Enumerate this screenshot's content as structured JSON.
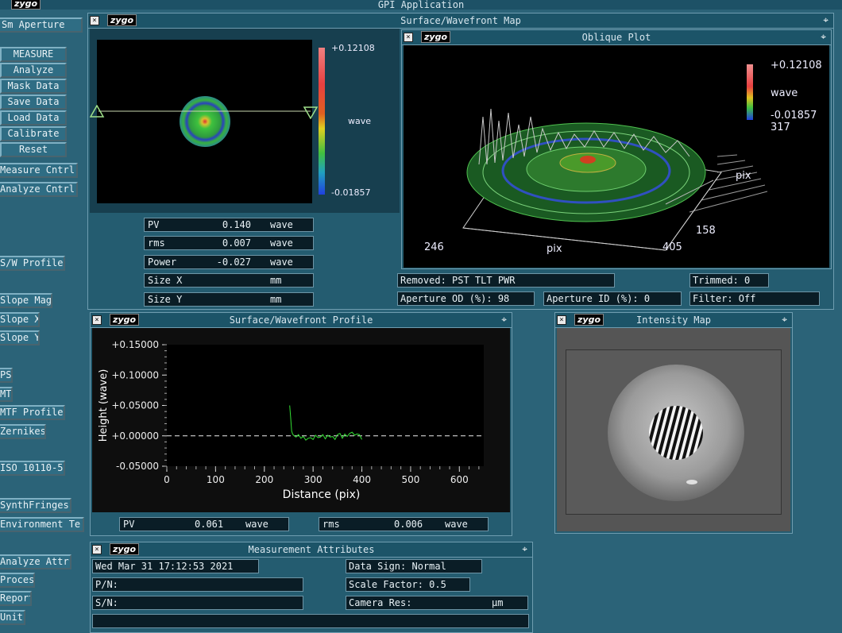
{
  "app": {
    "title": "GPI Application",
    "logo": "zygo"
  },
  "sidebar": {
    "top_label": "Sm Aperture",
    "buttons": [
      "MEASURE",
      "Analyze",
      "Mask Data",
      "Save Data",
      "Load Data",
      "Calibrate",
      "Reset"
    ],
    "items": [
      "Measure Cntrl",
      "Analyze Cntrl",
      "S/W Profile",
      "Slope Mag",
      "Slope X",
      "Slope Y",
      "PSF",
      "MTF",
      "MTF Profile",
      "Zernikes",
      "ISO 10110-5",
      "SynthFringes",
      "Environment Te",
      "Analyze Attr",
      "Process",
      "Report",
      "Units"
    ]
  },
  "surface_map": {
    "title": "Surface/Wavefront Map",
    "colorbar_max": "+0.12108",
    "colorbar_min": "-0.01857",
    "colorbar_unit": "wave",
    "results": [
      {
        "label": "PV",
        "value": "0.140",
        "unit": "wave"
      },
      {
        "label": "rms",
        "value": "0.007",
        "unit": "wave"
      },
      {
        "label": "Power",
        "value": "-0.027",
        "unit": "wave"
      },
      {
        "label": "Size X",
        "value": "",
        "unit": "mm"
      },
      {
        "label": "Size Y",
        "value": "",
        "unit": "mm"
      }
    ]
  },
  "oblique": {
    "title": "Oblique Plot",
    "colorbar_max": "+0.12108",
    "colorbar_unit": "wave",
    "colorbar_min": "-0.01857",
    "y_top": "317",
    "y_unit": "pix",
    "y_bottom": "158",
    "x_left": "246",
    "x_unit": "pix",
    "x_right": "405"
  },
  "status": {
    "removed": "Removed: PST TLT PWR",
    "trimmed": "Trimmed:  0",
    "aperture_od": "Aperture OD (%):  98",
    "aperture_id": "Aperture ID (%):  0",
    "filter": "Filter:     Off"
  },
  "profile": {
    "title": "Surface/Wavefront Profile",
    "pv_label": "PV",
    "pv_value": "0.061",
    "pv_unit": "wave",
    "rms_label": "rms",
    "rms_value": "0.006",
    "rms_unit": "wave"
  },
  "chart_data": {
    "type": "line",
    "xlabel": "Distance (pix)",
    "ylabel": "Height (wave)",
    "xlim": [
      0,
      650
    ],
    "ylim": [
      -0.05,
      0.15
    ],
    "xticks": [
      "0",
      "100",
      "200",
      "300",
      "400",
      "500",
      "600"
    ],
    "yticks": [
      "+0.15000",
      "+0.10000",
      "+0.05000",
      "+0.00000",
      "-0.05000"
    ],
    "series": [
      {
        "color": "#33dd33",
        "x": [
          252,
          254,
          256,
          258,
          260,
          265,
          270,
          275,
          280,
          285,
          290,
          295,
          300,
          305,
          310,
          315,
          320,
          325,
          330,
          335,
          340,
          345,
          350,
          355,
          360,
          365,
          370,
          375,
          380,
          385,
          390,
          395,
          400
        ],
        "y": [
          0.05,
          0.03,
          0.008,
          0.003,
          0.001,
          -0.002,
          0.002,
          -0.004,
          -0.001,
          -0.007,
          -0.004,
          -0.003,
          -0.006,
          0.001,
          -0.003,
          -0.002,
          0.002,
          -0.005,
          0.001,
          -0.002,
          -0.001,
          -0.006,
          0.002,
          0.004,
          -0.004,
          0.003,
          -0.001,
          0.004,
          0.006,
          0.001,
          0.003,
          0.002,
          -0.006
        ]
      }
    ]
  },
  "intensity": {
    "title": "Intensity Map"
  },
  "attributes": {
    "title": "Measurement Attributes",
    "date": "Wed Mar 31 17:12:53 2021",
    "pn": "P/N:",
    "sn": "S/N:",
    "data_sign": "Data Sign:   Normal",
    "scale_factor": "Scale Factor:  0.5",
    "camera_res_label": "Camera Res:",
    "camera_res_unit": "µm"
  },
  "colors": {
    "background": "#2b6378",
    "panel": "#245c70",
    "plot_bg": "#000000",
    "trace": "#33dd33"
  }
}
